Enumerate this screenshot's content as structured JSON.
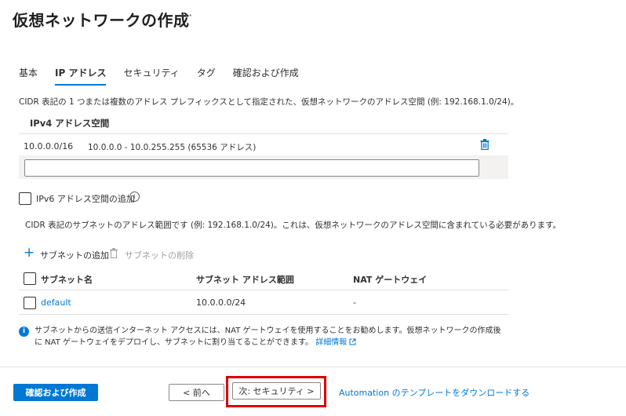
{
  "page": {
    "title": "仮想ネットワークの作成",
    "more": "···"
  },
  "tabs": [
    {
      "label": "基本"
    },
    {
      "label": "IP アドレス"
    },
    {
      "label": "セキュリティ"
    },
    {
      "label": "タグ"
    },
    {
      "label": "確認および作成"
    }
  ],
  "address_space": {
    "description": "CIDR 表記の 1 つまたは複数のアドレス プレフィックスとして指定された、仮想ネットワークのアドレス空間 (例: 192.168.1.0/24)。",
    "header": "IPv4 アドレス空間",
    "entry_cidr": "10.0.0.0/16",
    "entry_range": "10.0.0.0 - 10.0.255.255 (65536 アドレス)",
    "new_value": ""
  },
  "ipv6": {
    "label": "IPv6 アドレス空間の追加"
  },
  "subnet": {
    "description": "CIDR 表記のサブネットのアドレス範囲です (例: 192.168.1.0/24)。これは、仮想ネットワークのアドレス空間に含まれている必要があります。",
    "add_label": "サブネットの追加",
    "delete_label": "サブネットの削除",
    "columns": [
      "サブネット名",
      "サブネット アドレス範囲",
      "NAT ゲートウェイ"
    ],
    "rows": [
      {
        "name": "default",
        "range": "10.0.0.0/24",
        "nat": "-"
      }
    ]
  },
  "notice": {
    "text": "サブネットからの送信インターネット アクセスには、NAT ゲートウェイを使用することをお勧めします。仮想ネットワークの作成後に NAT ゲートウェイをデプロイし、サブネットに割り当てることができます。",
    "link": "詳細情報"
  },
  "footer": {
    "review_button": "確認および作成",
    "prev_button": "< 前へ",
    "next_button": "次: セキュリティ >",
    "download_link": "Automation のテンプレートをダウンロードする"
  },
  "colors": {
    "accent": "#0078d4",
    "highlight": "#e00000"
  }
}
